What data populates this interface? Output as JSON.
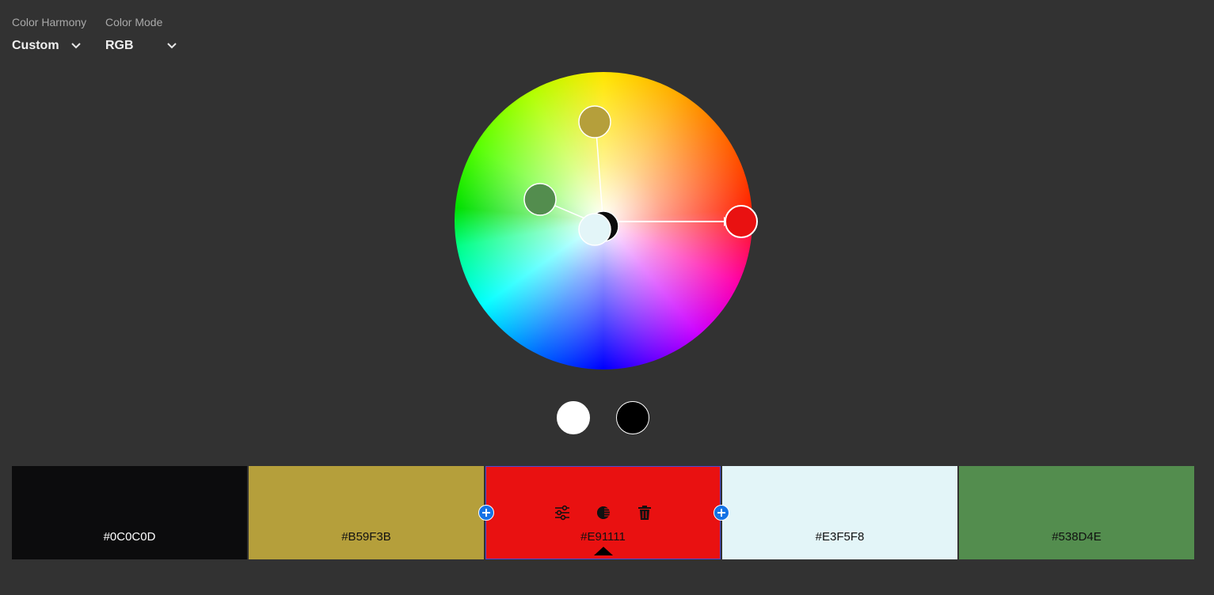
{
  "controls": {
    "harmony": {
      "label": "Color Harmony",
      "value": "Custom"
    },
    "mode": {
      "label": "Color Mode",
      "value": "RGB"
    }
  },
  "wheel": {
    "handles": [
      {
        "name": "handle-yellow-ochre",
        "color": "#B59F3B"
      },
      {
        "name": "handle-green",
        "color": "#538D4E"
      },
      {
        "name": "handle-red-base",
        "color": "#E91111"
      },
      {
        "name": "handle-light-blue",
        "color": "#E3F5F8"
      },
      {
        "name": "handle-black",
        "color": "#0C0C0D"
      }
    ]
  },
  "quick_swatches": [
    {
      "name": "white-swatch",
      "color": "#FFFFFF"
    },
    {
      "name": "black-swatch",
      "color": "#000000"
    }
  ],
  "palette": [
    {
      "hex": "#0C0C0D",
      "color": "#0C0C0D",
      "text_color": "#FFFFFF"
    },
    {
      "hex": "#B59F3B",
      "color": "#B59F3B",
      "text_color": "#111111"
    },
    {
      "hex": "#E91111",
      "color": "#E91111",
      "text_color": "#111111",
      "selected": true
    },
    {
      "hex": "#E3F5F8",
      "color": "#E3F5F8",
      "text_color": "#111111"
    },
    {
      "hex": "#538D4E",
      "color": "#538D4E",
      "text_color": "#111111"
    }
  ],
  "swatch_tools": [
    "sliders-icon",
    "contrast-icon",
    "trash-icon"
  ],
  "accent": "#1473E6"
}
